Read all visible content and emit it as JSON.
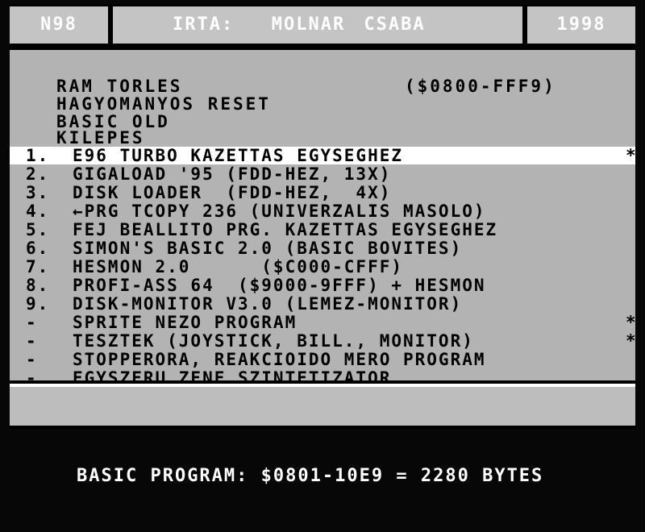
{
  "header": {
    "code": "N98",
    "author": "IRTA:  MOLNAR CSABA",
    "year": "1998"
  },
  "top_options": [
    {
      "label": "RAM TORLES"
    },
    {
      "label": "HAGYOMANYOS RESET"
    },
    {
      "label": "BASIC OLD"
    },
    {
      "label": "KILEPES"
    }
  ],
  "ram_range": "($0800-FFF9)",
  "menu": [
    {
      "num": "1.",
      "label": "E96 TURBO KAZETTAS EGYSEGHEZ",
      "mark": "*",
      "selected": true
    },
    {
      "num": "2.",
      "label": "GIGALOAD '95 (FDD-HEZ, 13X)",
      "mark": ""
    },
    {
      "num": "3.",
      "label": "DISK LOADER  (FDD-HEZ,  4X)",
      "mark": ""
    },
    {
      "num": "4.",
      "label": "←PRG TCOPY 236 (UNIVERZALIS MASOLO)",
      "mark": ""
    },
    {
      "num": "5.",
      "label": "FEJ BEALLITO PRG. KAZETTAS EGYSEGHEZ",
      "mark": ""
    },
    {
      "num": "6.",
      "label": "SIMON'S BASIC 2.0 (BASIC BOVITES)",
      "mark": ""
    },
    {
      "num": "7.",
      "label": "HESMON 2.0      ($C000-CFFF)",
      "mark": ""
    },
    {
      "num": "8.",
      "label": "PROFI-ASS 64  ($9000-9FFF) + HESMON",
      "mark": ""
    },
    {
      "num": "9.",
      "label": "DISK-MONITOR V3.0 (LEMEZ-MONITOR)",
      "mark": ""
    },
    {
      "num": "-",
      "label": "SPRITE NEZO PROGRAM",
      "mark": "*"
    },
    {
      "num": "-",
      "label": "TESZTEK (JOYSTICK, BILL., MONITOR)",
      "mark": "*"
    },
    {
      "num": "-",
      "label": "STOPPERORA, REAKCIOIDO MERO PROGRAM",
      "mark": ""
    },
    {
      "num": "-",
      "label": "EGYSZERU ZENE SZINTETIZATOR",
      "mark": ""
    }
  ],
  "status": "BASIC PROGRAM: $0801-10E9 = 2280 BYTES",
  "colors": {
    "panel": "#b3b3b3",
    "selected_row": "#ffffff",
    "header_box": "#c4c4c4",
    "text_dark": "#000000",
    "text_light": "#ffffff"
  }
}
